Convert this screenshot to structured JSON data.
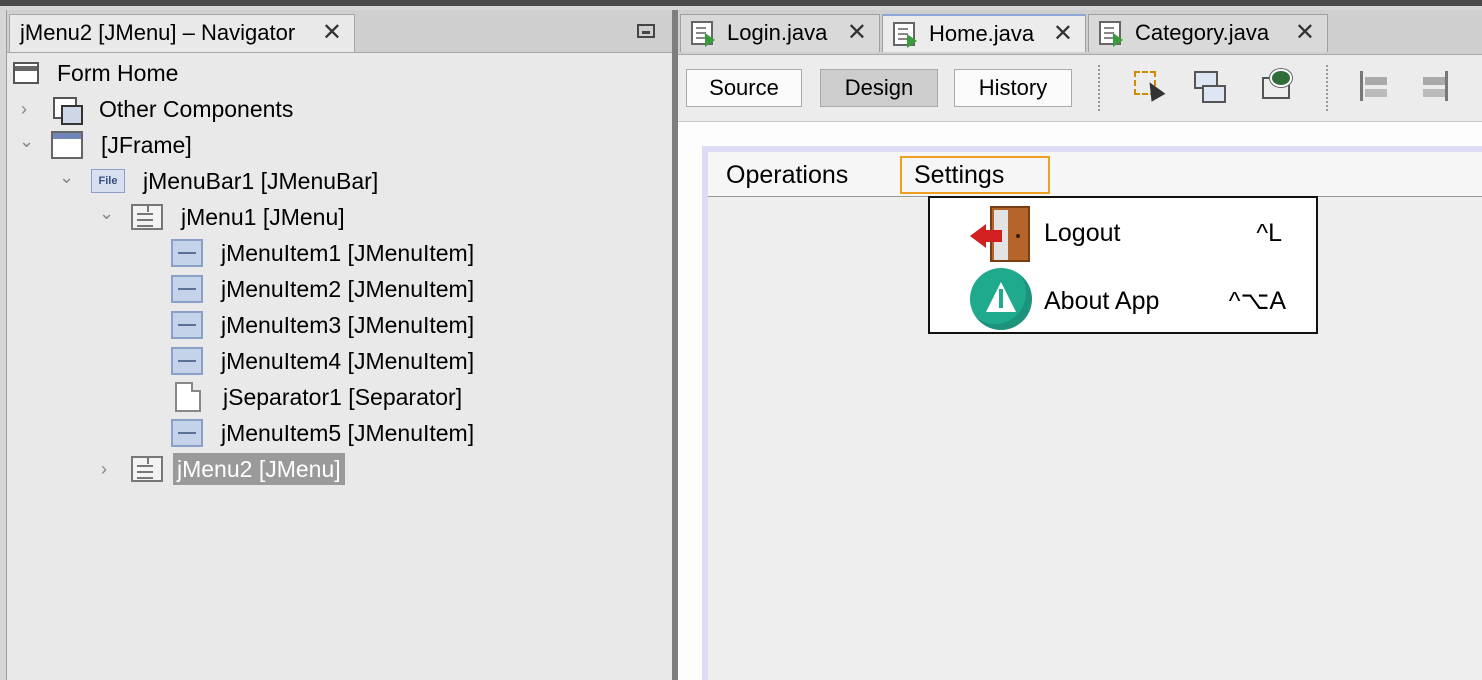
{
  "navigator": {
    "tab_title": "jMenu2 [JMenu] – Navigator",
    "close_glyph": "✕",
    "tree": [
      {
        "label": "Form Home",
        "icon": "form-icon",
        "level": 0,
        "chevron": ""
      },
      {
        "label": "Other Components",
        "icon": "other-components-icon",
        "level": 1,
        "chevron": "›"
      },
      {
        "label": "[JFrame]",
        "icon": "jframe-icon",
        "level": 1,
        "chevron": "⌄"
      },
      {
        "label": "jMenuBar1 [JMenuBar]",
        "icon": "menubar-file-icon",
        "level": 2,
        "chevron": "⌄"
      },
      {
        "label": "jMenu1 [JMenu]",
        "icon": "menu-icon",
        "level": 3,
        "chevron": "⌄"
      },
      {
        "label": "jMenuItem1 [JMenuItem]",
        "icon": "menuitem-icon",
        "level": 4,
        "chevron": ""
      },
      {
        "label": "jMenuItem2 [JMenuItem]",
        "icon": "menuitem-icon",
        "level": 4,
        "chevron": ""
      },
      {
        "label": "jMenuItem3 [JMenuItem]",
        "icon": "menuitem-icon",
        "level": 4,
        "chevron": ""
      },
      {
        "label": "jMenuItem4 [JMenuItem]",
        "icon": "menuitem-icon",
        "level": 4,
        "chevron": ""
      },
      {
        "label": "jSeparator1 [Separator]",
        "icon": "separator-icon",
        "level": 4,
        "chevron": ""
      },
      {
        "label": "jMenuItem5 [JMenuItem]",
        "icon": "menuitem-icon",
        "level": 4,
        "chevron": ""
      },
      {
        "label": "jMenu2 [JMenu]",
        "icon": "menu-icon",
        "level": 3,
        "chevron": "›",
        "selected": true
      }
    ]
  },
  "editor": {
    "tabs": [
      {
        "label": "Login.java",
        "active": false
      },
      {
        "label": "Home.java",
        "active": true
      },
      {
        "label": "Category.java",
        "active": false
      }
    ],
    "close_glyph": "✕",
    "toolbar": {
      "source_label": "Source",
      "design_label": "Design",
      "history_label": "History"
    },
    "menubar": {
      "items": [
        "Operations",
        "Settings"
      ]
    },
    "popup": {
      "items": [
        {
          "label": "Logout",
          "shortcut": "^L",
          "icon": "logout-door-icon"
        },
        {
          "label": "About App",
          "shortcut": "^⌥A",
          "icon": "info-icon"
        }
      ]
    }
  },
  "colors": {
    "selection_bg": "#9a9a9a",
    "menu_highlight_border": "#f0a020",
    "info_icon": "#1fa98d",
    "logout_arrow": "#d21f1f"
  }
}
